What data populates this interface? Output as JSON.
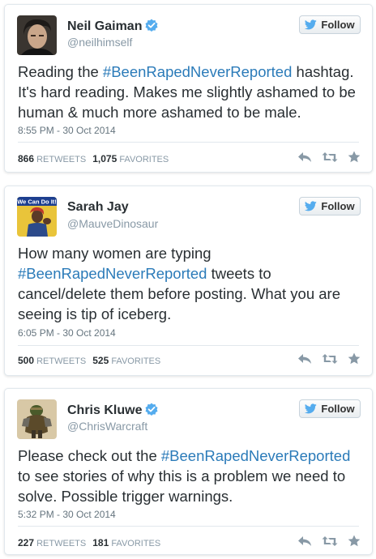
{
  "follow_label": "Follow",
  "colors": {
    "link": "#2b7bb9",
    "verified": "#55acee",
    "twitter_bird": "#55acee",
    "icon_gray": "#8899a6"
  },
  "tweets": [
    {
      "name": "Neil Gaiman",
      "verified": true,
      "handle": "@neilhimself",
      "text_before": "Reading the ",
      "hashtag": "#BeenRapedNeverReported",
      "text_after": " hashtag. It's hard reading. Makes me slightly ashamed to be human & much more ashamed to be male.",
      "timestamp": "8:55 PM - 30 Oct 2014",
      "retweets": "866",
      "retweets_label": "RETWEETS",
      "favorites": "1,075",
      "favorites_label": "FAVORITES"
    },
    {
      "name": "Sarah Jay",
      "verified": false,
      "handle": "@MauveDinosaur",
      "avatar_text": "We Can Do It!",
      "text_before": "How many women are typing ",
      "hashtag": "#BeenRapedNeverReported",
      "text_after": " tweets to cancel/delete them before posting. What you are seeing is tip of iceberg.",
      "timestamp": "6:05 PM - 30 Oct 2014",
      "retweets": "500",
      "retweets_label": "RETWEETS",
      "favorites": "525",
      "favorites_label": "FAVORITES"
    },
    {
      "name": "Chris Kluwe",
      "verified": true,
      "handle": "@ChrisWarcraft",
      "text_before": "Please check out the ",
      "hashtag": "#BeenRapedNeverReported",
      "text_after": " to see stories of why this is a problem we need to solve. Possible trigger warnings.",
      "timestamp": "5:32 PM - 30 Oct 2014",
      "retweets": "227",
      "retweets_label": "RETWEETS",
      "favorites": "181",
      "favorites_label": "FAVORITES"
    }
  ]
}
